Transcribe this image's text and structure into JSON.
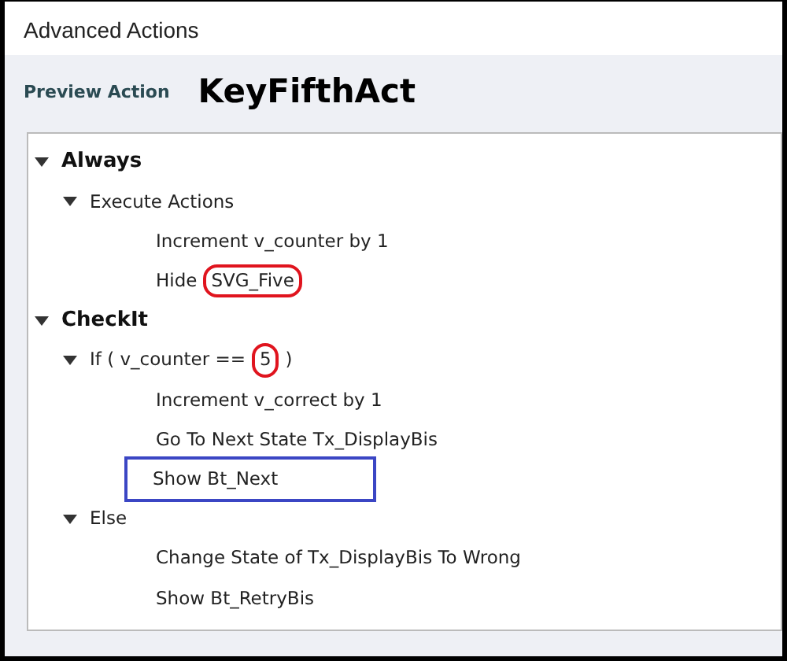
{
  "window": {
    "title": "Advanced Actions"
  },
  "header": {
    "label": "Preview Action",
    "action_name": "KeyFifthAct"
  },
  "tree": [
    {
      "parts": [
        {
          "text": "Always",
          "circled": false
        }
      ],
      "boxed": false,
      "expanded": true,
      "children": [
        {
          "parts": [
            {
              "text": "Execute Actions",
              "circled": false
            }
          ],
          "boxed": false,
          "expanded": true,
          "children": [
            {
              "parts": [
                {
                  "text": "Increment v_counter by 1",
                  "circled": false
                }
              ],
              "boxed": false
            },
            {
              "parts": [
                {
                  "text": "Hide",
                  "circled": false
                },
                {
                  "text": "SVG_Five",
                  "circled": true
                }
              ],
              "boxed": false
            }
          ]
        }
      ]
    },
    {
      "parts": [
        {
          "text": "CheckIt",
          "circled": false
        }
      ],
      "boxed": false,
      "expanded": true,
      "children": [
        {
          "parts": [
            {
              "text": "If ( v_counter ==",
              "circled": false
            },
            {
              "text": "5",
              "circled": true
            },
            {
              "text": ")",
              "circled": false
            }
          ],
          "boxed": false,
          "expanded": true,
          "children": [
            {
              "parts": [
                {
                  "text": "Increment v_correct by 1",
                  "circled": false
                }
              ],
              "boxed": false
            },
            {
              "parts": [
                {
                  "text": "Go To Next State Tx_DisplayBis",
                  "circled": false
                }
              ],
              "boxed": false
            },
            {
              "parts": [
                {
                  "text": "Show Bt_Next",
                  "circled": false
                }
              ],
              "boxed": true
            }
          ]
        },
        {
          "parts": [
            {
              "text": "Else",
              "circled": false
            }
          ],
          "boxed": false,
          "expanded": true,
          "children": [
            {
              "parts": [
                {
                  "text": "Change State of Tx_DisplayBis To Wrong",
                  "circled": false
                }
              ],
              "boxed": false
            },
            {
              "parts": [
                {
                  "text": "Show Bt_RetryBis",
                  "circled": false
                }
              ],
              "boxed": false
            }
          ]
        }
      ]
    }
  ]
}
